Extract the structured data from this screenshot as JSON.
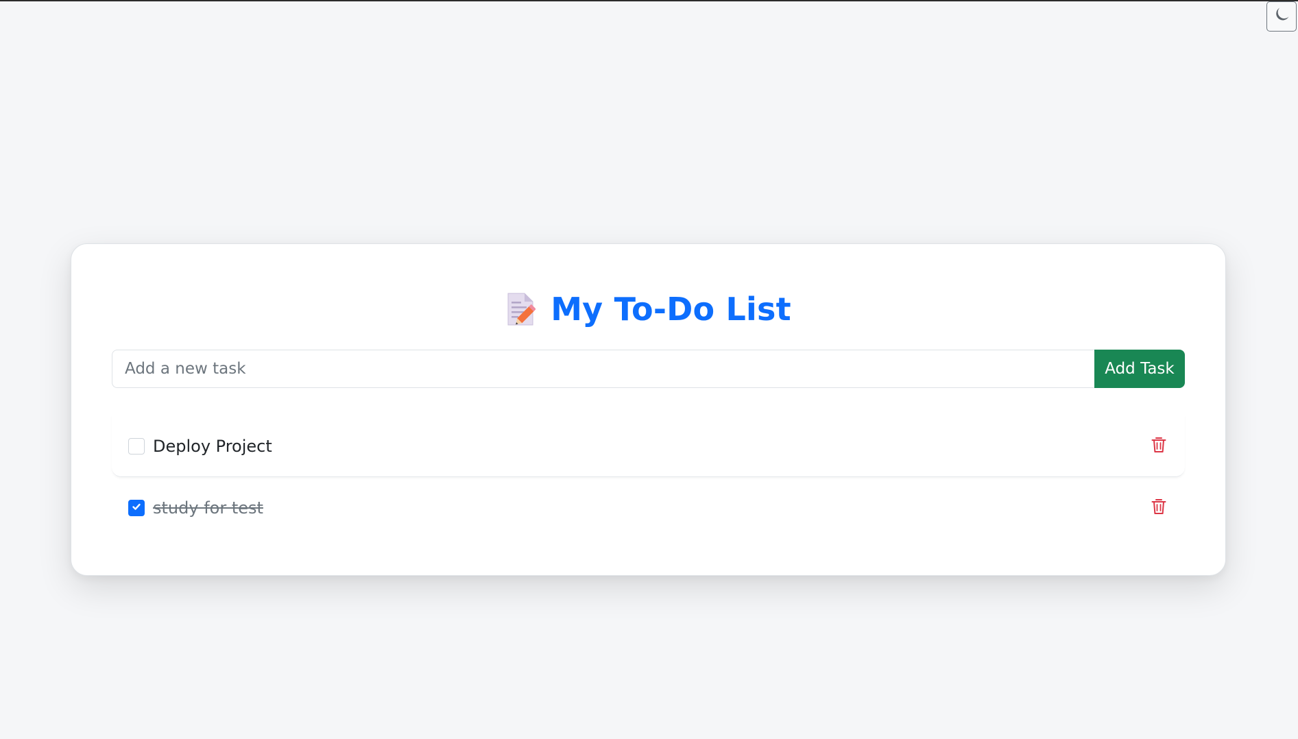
{
  "header": {
    "title": "My To-Do List",
    "title_icon": "memo-icon",
    "title_color": "#0d6efd"
  },
  "theme_toggle": {
    "icon": "moon-icon"
  },
  "add_form": {
    "placeholder": "Add a new task",
    "value": "",
    "button_label": "Add Task",
    "button_color": "#198754"
  },
  "tasks": [
    {
      "label": "Deploy Project",
      "completed": false
    },
    {
      "label": "study for test",
      "completed": true
    }
  ],
  "colors": {
    "accent": "#0d6efd",
    "danger": "#dc3545",
    "background": "#f5f6f8"
  }
}
